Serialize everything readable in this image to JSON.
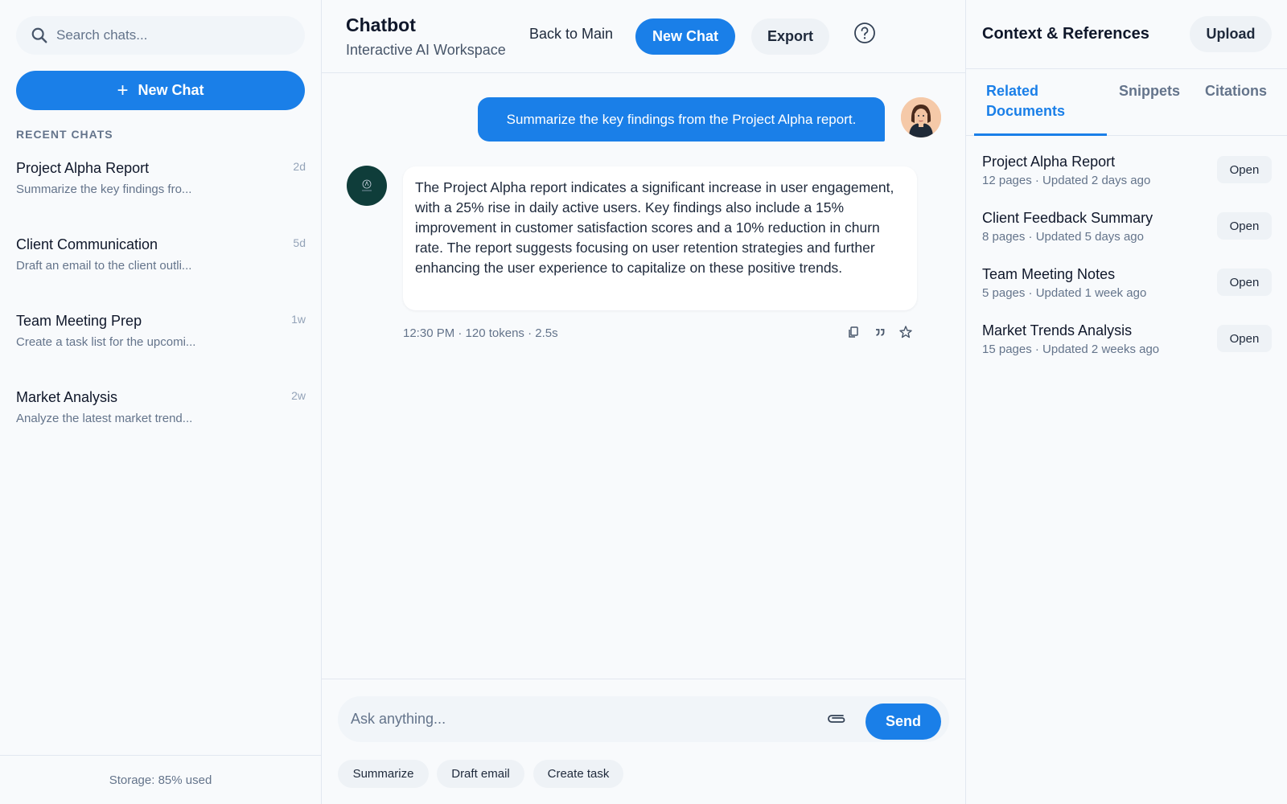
{
  "sidebar": {
    "search_placeholder": "Search chats...",
    "new_chat_label": "New Chat",
    "recent_title": "RECENT CHATS",
    "chats": [
      {
        "title": "Project Alpha Report",
        "time": "2d",
        "preview": "Summarize the key findings fro..."
      },
      {
        "title": "Client Communication",
        "time": "5d",
        "preview": "Draft an email to the client outli..."
      },
      {
        "title": "Team Meeting Prep",
        "time": "1w",
        "preview": "Create a task list for the upcomi..."
      },
      {
        "title": "Market Analysis",
        "time": "2w",
        "preview": "Analyze the latest market trend..."
      }
    ],
    "storage": "Storage: 85% used"
  },
  "header": {
    "title": "Chatbot",
    "subtitle": "Interactive AI Workspace",
    "back_label": "Back to Main",
    "new_chat_label": "New Chat",
    "export_label": "Export",
    "help_icon": "question-circle-icon"
  },
  "conversation": {
    "user_message": "Summarize the key findings from the Project Alpha report.",
    "bot_message": "The Project Alpha report indicates a significant increase in user engagement, with a 25% rise in daily active users. Key findings also include a 15% improvement in customer satisfaction scores and a 10% reduction in churn rate. The report suggests focusing on user retention strategies and further enhancing the user experience to capitalize on these positive trends.",
    "bot_meta": "12:30 PM · 120 tokens · 2.5s",
    "actions": [
      "copy-icon",
      "quote-icon",
      "star-icon"
    ]
  },
  "composer": {
    "placeholder": "Ask anything...",
    "send_label": "Send",
    "chips": [
      "Summarize",
      "Draft email",
      "Create task"
    ]
  },
  "right_panel": {
    "title": "Context & References",
    "upload_label": "Upload",
    "tabs": [
      "Related Documents",
      "Snippets",
      "Citations"
    ],
    "active_tab": "Related Documents",
    "documents": [
      {
        "title": "Project Alpha Report",
        "meta": "12 pages · Updated 2 days ago",
        "action": "Open"
      },
      {
        "title": "Client Feedback Summary",
        "meta": "8 pages · Updated 5 days ago",
        "action": "Open"
      },
      {
        "title": "Team Meeting Notes",
        "meta": "5 pages · Updated 1 week ago",
        "action": "Open"
      },
      {
        "title": "Market Trends Analysis",
        "meta": "15 pages · Updated 2 weeks ago",
        "action": "Open"
      }
    ]
  },
  "colors": {
    "accent": "#1a7fe8",
    "background": "#f8fafc",
    "chip": "#eef2f6",
    "bot_avatar": "#0f3d3a"
  }
}
